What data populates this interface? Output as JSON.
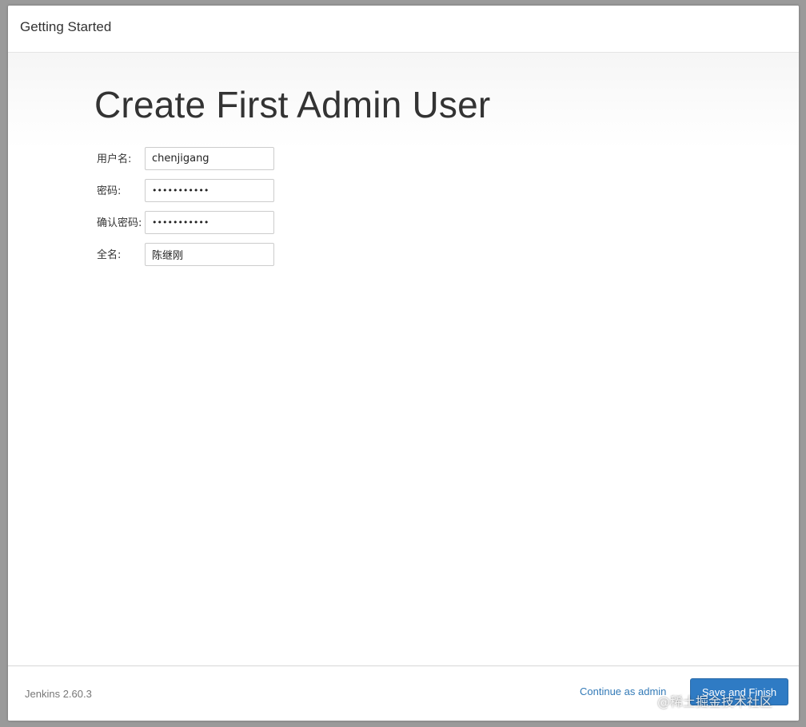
{
  "header": {
    "title": "Getting Started"
  },
  "main": {
    "title": "Create First Admin User",
    "fields": {
      "username": {
        "label": "用户名:",
        "value": "chenjigang"
      },
      "password": {
        "label": "密码:",
        "value": "•••••••••••"
      },
      "confirm_password": {
        "label": "确认密码:",
        "value": "•••••••••••"
      },
      "fullname": {
        "label": "全名:",
        "value": "陈继刚"
      }
    }
  },
  "footer": {
    "version": "Jenkins 2.60.3",
    "continue_label": "Continue as admin",
    "save_label": "Save and Finish"
  },
  "watermark": "@稀土掘金技术社区",
  "colors": {
    "primary_button": "#2f7bc4",
    "link": "#337ab7"
  }
}
